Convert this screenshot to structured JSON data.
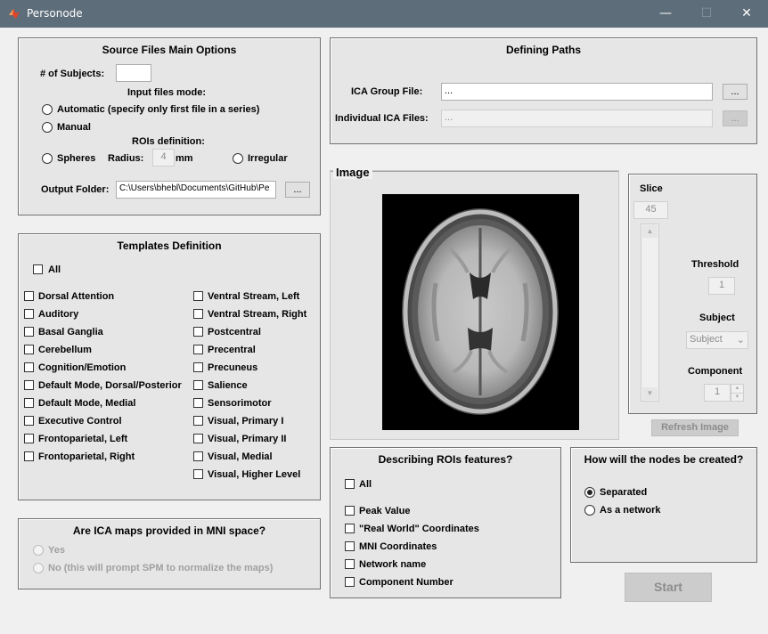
{
  "window": {
    "title": "Personode",
    "minimize_glyph": "—",
    "maximize_glyph": "☐",
    "close_glyph": "✕"
  },
  "source": {
    "title": "Source Files Main Options",
    "subjects_label": "# of Subjects:",
    "subjects_value": "",
    "input_mode_label": "Input files mode:",
    "automatic_label": "Automatic (specify only first file in a series)",
    "manual_label": "Manual",
    "rois_label": "ROIs definition:",
    "spheres_label": "Spheres",
    "radius_label": "Radius:",
    "radius_value": "4",
    "mm_label": "mm",
    "irregular_label": "Irregular",
    "output_label": "Output Folder:",
    "output_value": "C:\\Users\\bhebl\\Documents\\GitHub\\Pe",
    "browse_label": "..."
  },
  "paths": {
    "title": "Defining Paths",
    "group_label": "ICA Group File:",
    "group_value": "...",
    "group_browse": "...",
    "individual_label": "Individual ICA Files:",
    "individual_value": "...",
    "individual_browse": "..."
  },
  "templates": {
    "title": "Templates Definition",
    "all_label": "All",
    "left": [
      "Dorsal Attention",
      "Auditory",
      "Basal Ganglia",
      "Cerebellum",
      "Cognition/Emotion",
      "Default Mode, Dorsal/Posterior",
      "Default Mode, Medial",
      "Executive Control",
      "Frontoparietal, Left",
      "Frontoparietal, Right"
    ],
    "right": [
      "Ventral Stream, Left",
      "Ventral Stream, Right",
      "Postcentral",
      "Precentral",
      "Precuneus",
      "Salience",
      "Sensorimotor",
      "Visual, Primary I",
      "Visual, Primary II",
      "Visual, Medial",
      "Visual, Higher Level"
    ]
  },
  "mni": {
    "title": "Are ICA maps provided in MNI space?",
    "yes_label": "Yes",
    "no_label": "No (this will prompt SPM to normalize the maps)"
  },
  "image": {
    "title": "Image"
  },
  "controls": {
    "slice_label": "Slice",
    "slice_value": "45",
    "threshold_label": "Threshold",
    "threshold_value": "1",
    "subject_label": "Subject",
    "subject_value": "Subject",
    "component_label": "Component",
    "component_value": "1",
    "refresh_label": "Refresh Image"
  },
  "features": {
    "title": "Describing ROIs features?",
    "all_label": "All",
    "items": [
      "Peak Value",
      "\"Real World\" Coordinates",
      "MNI Coordinates",
      "Network name",
      "Component Number"
    ]
  },
  "nodes": {
    "title": "How will the nodes be created?",
    "separated_label": "Separated",
    "network_label": "As a network",
    "selected": "Separated"
  },
  "start_label": "Start"
}
